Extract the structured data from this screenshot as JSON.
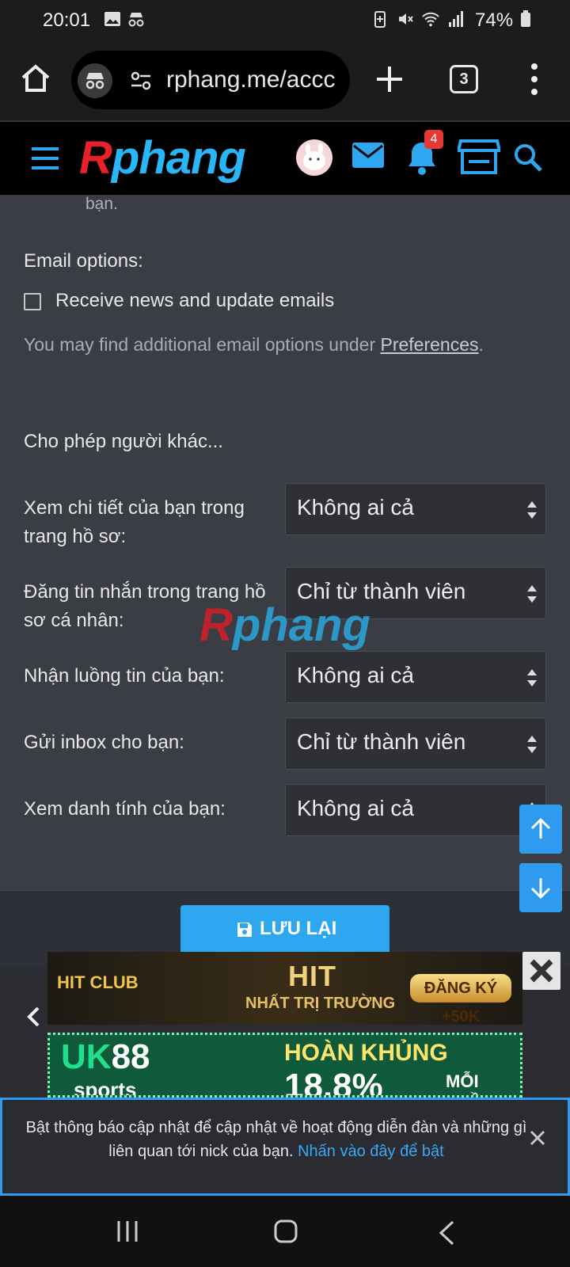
{
  "status_bar": {
    "time": "20:01",
    "battery_percent": "74%",
    "icons": [
      "gallery-icon",
      "incognito-icon",
      "battery-saver-icon",
      "mute-icon",
      "wifi-icon",
      "signal-icon",
      "battery-icon"
    ]
  },
  "browser": {
    "url": "rphang.me/accc",
    "tab_count": "3"
  },
  "site_header": {
    "logo_r": "R",
    "logo_rest": "phang",
    "notification_count": "4"
  },
  "content": {
    "truncated_text": "bạn.",
    "email_options_label": "Email options:",
    "checkbox_label": "Receive news and update emails",
    "checkbox_checked": false,
    "hint_prefix": "You may find additional email options under ",
    "hint_link": "Preferences",
    "hint_suffix": ".",
    "allow_others_label": "Cho phép người khác...",
    "rows": [
      {
        "label": "Xem chi tiết của bạn trong trang hồ sơ:",
        "value": "Không ai cả"
      },
      {
        "label": "Đăng tin nhắn trong trang hồ sơ cá nhân:",
        "value": "Chỉ từ thành viên"
      },
      {
        "label": "Nhận luồng tin của bạn:",
        "value": "Không ai cả"
      },
      {
        "label": "Gửi inbox cho bạn:",
        "value": "Chỉ từ thành viên"
      },
      {
        "label": "Xem danh tính của bạn:",
        "value": "Không ai cả"
      }
    ],
    "save_label": "LƯU LẠI"
  },
  "ads": {
    "ad1_brand": "HIT CLUB",
    "ad1_title": "HIT",
    "ad1_subtitle": "NHẤT TRỊ TRƯỜNG",
    "ad1_cta": "ĐĂNG KÝ +50K",
    "ad2_brand_a": "UK",
    "ad2_brand_b": "88",
    "ad2_sub": "sports",
    "ad2_headline": "HOÀN KHỦNG",
    "ad2_percent": "18.8%",
    "ad2_suffix": "MỖI TUẦN"
  },
  "notification_banner": {
    "message": "Bật thông báo cập nhật để cập nhật về hoạt động diễn đàn và những gì liên quan tới nick của bạn. ",
    "link": "Nhấn vào đây để bật"
  },
  "colors": {
    "accent": "#2fa6f0",
    "logo_red": "#e8202a",
    "logo_blue": "#29b6f6",
    "content_bg": "#3b3d45"
  }
}
